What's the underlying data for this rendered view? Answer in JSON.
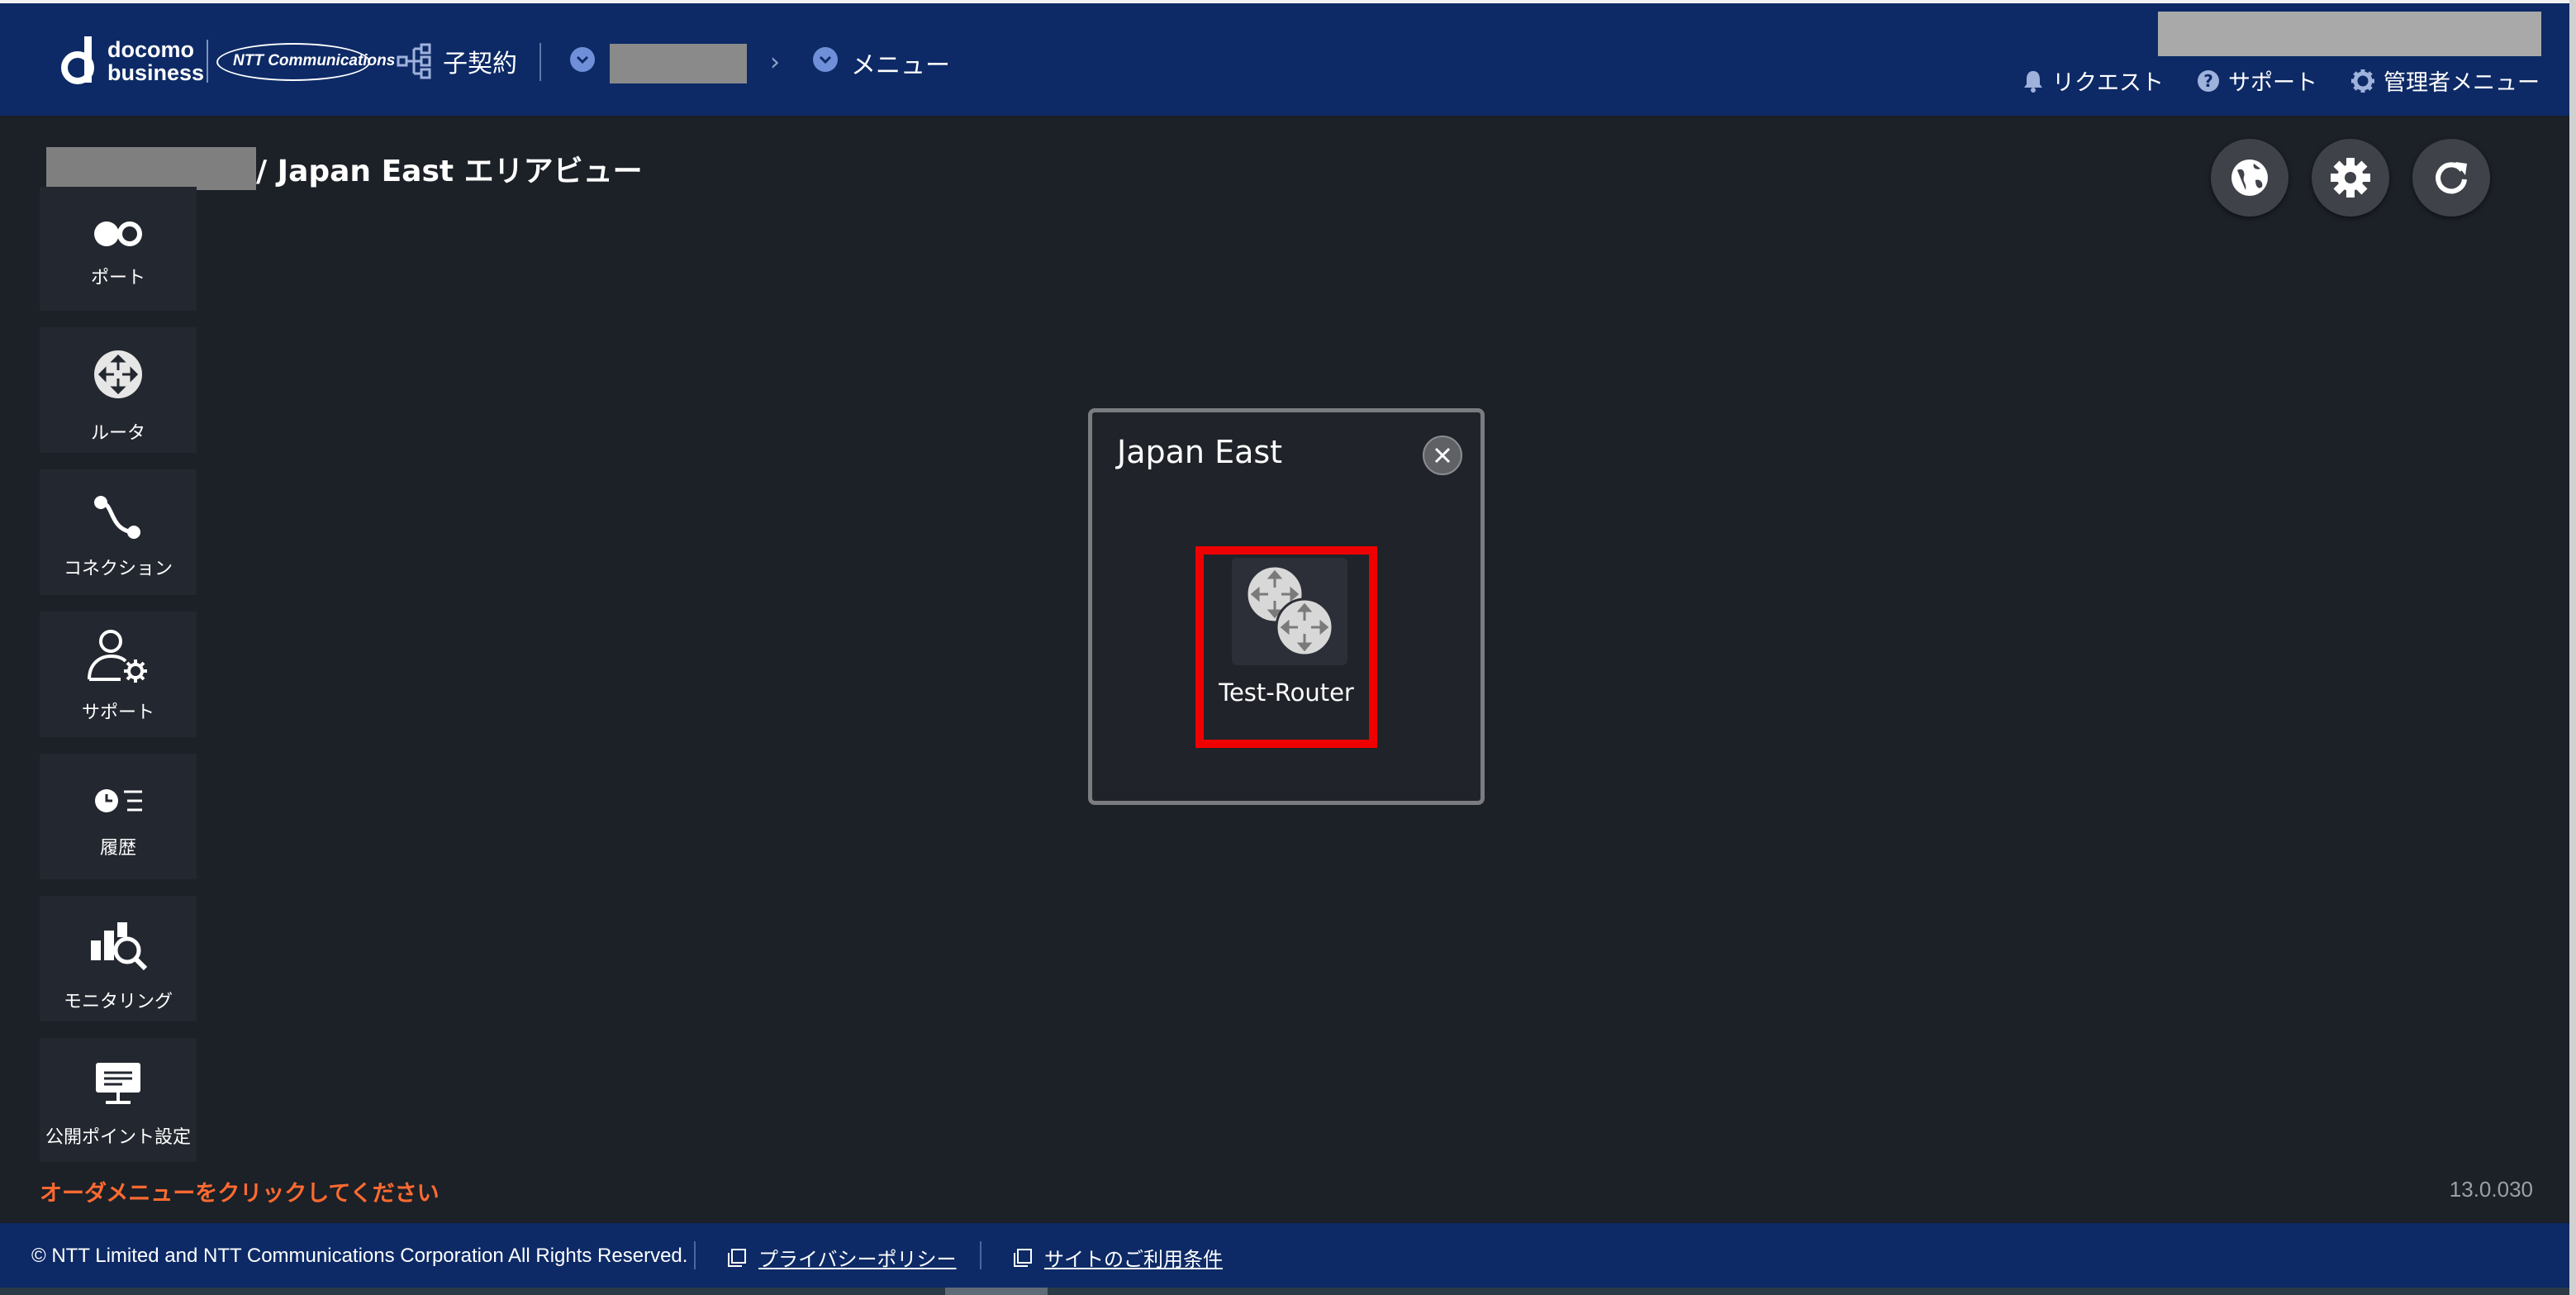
{
  "header": {
    "brand_line1": "docomo",
    "brand_line2": "business",
    "ntt_logo": "NTT Communications",
    "contract_label": "子契約",
    "menu_label": "メニュー",
    "links": {
      "request": "リクエスト",
      "support": "サポート",
      "admin_menu": "管理者メニュー"
    }
  },
  "page": {
    "title": "/ Japan East エリアビュー"
  },
  "sidebar": {
    "items": [
      {
        "label": "ポート",
        "icon": "port-icon"
      },
      {
        "label": "ルータ",
        "icon": "router-icon"
      },
      {
        "label": "コネクション",
        "icon": "connection-icon"
      },
      {
        "label": "サポート",
        "icon": "support-user-gear-icon"
      },
      {
        "label": "履歴",
        "icon": "history-icon"
      },
      {
        "label": "モニタリング",
        "icon": "monitoring-icon"
      },
      {
        "label": "公開ポイント設定",
        "icon": "public-point-monitor-icon"
      }
    ]
  },
  "order_hint": "オーダメニューをクリックしてください",
  "version": "13.0.030",
  "dialog": {
    "title": "Japan East",
    "router": {
      "label": "Test-Router"
    }
  },
  "footer": {
    "copyright": "© NTT Limited and NTT Communications Corporation All Rights Reserved.",
    "privacy": "プライバシーポリシー",
    "terms": "サイトのご利用条件"
  },
  "colors": {
    "header_bg": "#0d2a66",
    "page_bg": "#1c2027",
    "highlight_border": "#ee0000",
    "hint_text": "#ff6a30"
  }
}
